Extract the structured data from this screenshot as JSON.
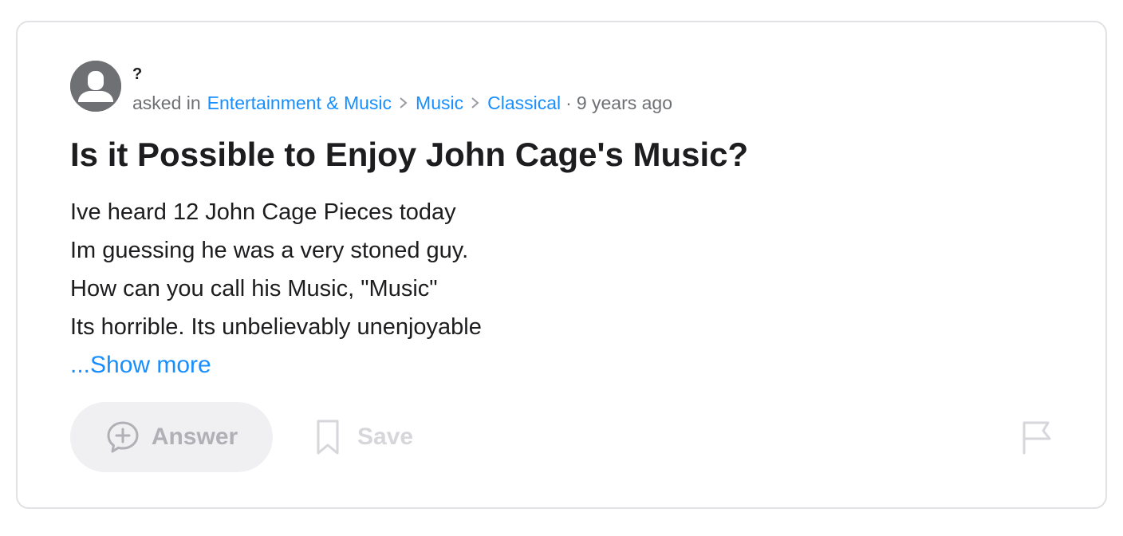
{
  "question": {
    "user": {
      "name": "?",
      "avatar_icon": "default-user-avatar-icon"
    },
    "asked_prefix": "asked in",
    "categories": [
      "Entertainment & Music",
      "Music",
      "Classical"
    ],
    "separator": "·",
    "time_ago": "9 years ago",
    "title": "Is it Possible to Enjoy John Cage's Music?",
    "body_lines": [
      "Ive heard 12 John Cage Pieces today",
      "Im guessing he was a very stoned guy.",
      "How can you call his Music, \"Music\"",
      "Its horrible. Its unbelievably unenjoyable"
    ],
    "show_more_label": "...Show more"
  },
  "actions": {
    "answer_label": "Answer",
    "answer_icon": "add-comment-icon",
    "save_label": "Save",
    "save_icon": "bookmark-icon",
    "report_icon": "flag-icon"
  },
  "colors": {
    "link": "#188fff",
    "text": "#1d1d1f",
    "muted": "#6e7073",
    "disabled": "#b0b0b6"
  }
}
